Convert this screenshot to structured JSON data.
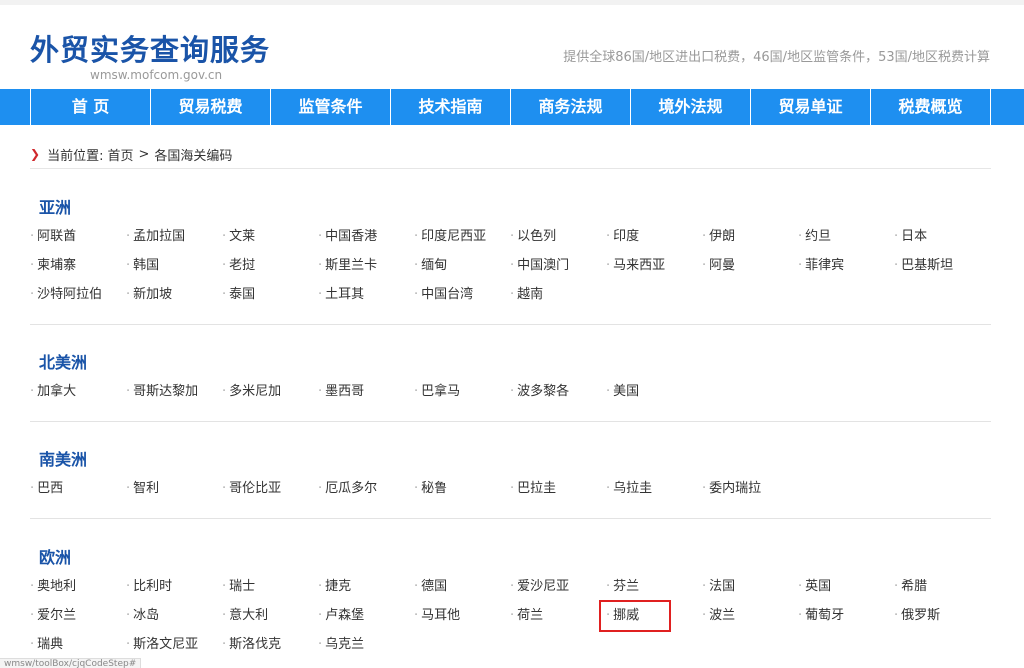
{
  "header": {
    "title": "外贸实务查询服务",
    "domain": "wmsw.mofcom.gov.cn",
    "description": "提供全球86国/地区进出口税费，46国/地区监管条件，53国/地区税费计算"
  },
  "nav": {
    "items": [
      "首 页",
      "贸易税费",
      "监管条件",
      "技术指南",
      "商务法规",
      "境外法规",
      "贸易单证",
      "税费概览"
    ]
  },
  "breadcrumb": {
    "prefix": "当前位置:",
    "home": "首页",
    "separator": ">",
    "current": "各国海关编码"
  },
  "regions": {
    "asia": {
      "title": "亚洲",
      "countries": [
        "阿联酋",
        "孟加拉国",
        "文莱",
        "中国香港",
        "印度尼西亚",
        "以色列",
        "印度",
        "伊朗",
        "约旦",
        "日本",
        "柬埔寨",
        "韩国",
        "老挝",
        "斯里兰卡",
        "缅甸",
        "中国澳门",
        "马来西亚",
        "阿曼",
        "菲律宾",
        "巴基斯坦",
        "沙特阿拉伯",
        "新加坡",
        "泰国",
        "土耳其",
        "中国台湾",
        "越南"
      ]
    },
    "north_america": {
      "title": "北美洲",
      "countries": [
        "加拿大",
        "哥斯达黎加",
        "多米尼加",
        "墨西哥",
        "巴拿马",
        "波多黎各",
        "美国"
      ]
    },
    "south_america": {
      "title": "南美洲",
      "countries": [
        "巴西",
        "智利",
        "哥伦比亚",
        "厄瓜多尔",
        "秘鲁",
        "巴拉圭",
        "乌拉圭",
        "委内瑞拉"
      ]
    },
    "europe": {
      "title": "欧洲",
      "countries": [
        "奥地利",
        "比利时",
        "瑞士",
        "捷克",
        "德国",
        "爱沙尼亚",
        "芬兰",
        "法国",
        "英国",
        "希腊",
        "爱尔兰",
        "冰岛",
        "意大利",
        "卢森堡",
        "马耳他",
        "荷兰",
        "挪威",
        "波兰",
        "葡萄牙",
        "俄罗斯",
        "瑞典",
        "斯洛文尼亚",
        "斯洛伐克",
        "乌克兰"
      ],
      "selected": "挪威"
    }
  },
  "status_url": "wmsw/toolBox/cjqCodeStep#"
}
